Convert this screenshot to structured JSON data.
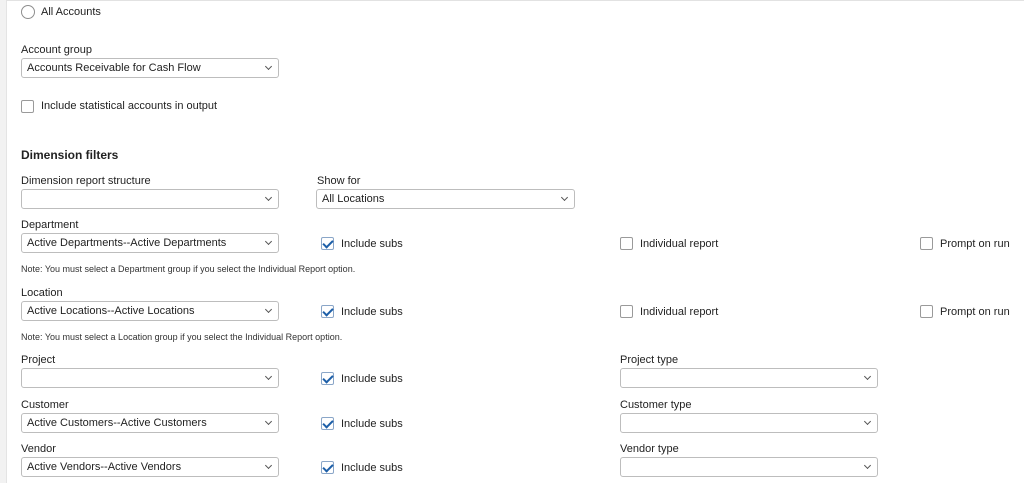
{
  "accounts": {
    "all_accounts_label": "All Accounts"
  },
  "account_group": {
    "label": "Account group",
    "value": "Accounts Receivable for Cash Flow",
    "statistical_label": "Include statistical accounts in output"
  },
  "dimension_filters": {
    "heading": "Dimension filters",
    "structure": {
      "label": "Dimension report structure",
      "value": ""
    },
    "show_for": {
      "label": "Show for",
      "value": "All Locations"
    }
  },
  "department": {
    "label": "Department",
    "value": "Active Departments--Active Departments",
    "include_subs": "Include subs",
    "individual_report": "Individual report",
    "prompt_on_run": "Prompt on run",
    "note": "Note: You must select a Department group if you select the Individual Report option."
  },
  "location": {
    "label": "Location",
    "value": "Active Locations--Active Locations",
    "include_subs": "Include subs",
    "individual_report": "Individual report",
    "prompt_on_run": "Prompt on run",
    "note": "Note: You must select a Location group if you select the Individual Report option."
  },
  "project": {
    "label": "Project",
    "value": "",
    "include_subs": "Include subs",
    "type_label": "Project type",
    "type_value": ""
  },
  "customer": {
    "label": "Customer",
    "value": "Active Customers--Active Customers",
    "include_subs": "Include subs",
    "type_label": "Customer type",
    "type_value": ""
  },
  "vendor": {
    "label": "Vendor",
    "value": "Active Vendors--Active Vendors",
    "include_subs": "Include subs",
    "type_label": "Vendor type",
    "type_value": ""
  }
}
